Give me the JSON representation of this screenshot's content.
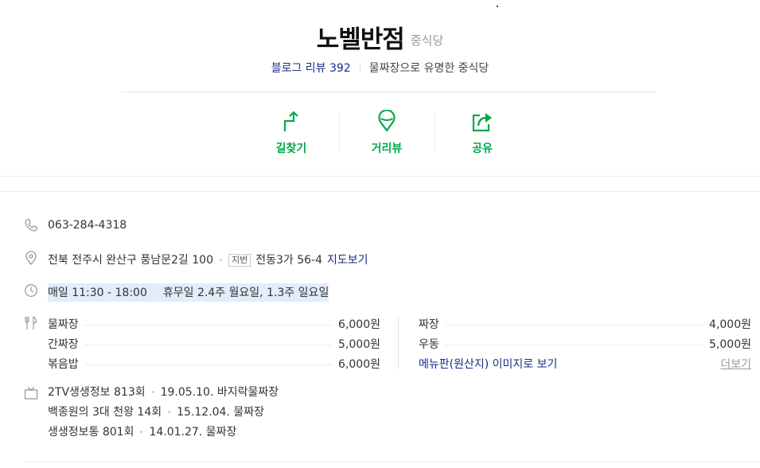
{
  "place": {
    "name": "노벨반점",
    "category": "중식당",
    "blog_review_label": "블로그 리뷰 392",
    "description": "물짜장으로 유명한 중식당"
  },
  "actions": [
    {
      "label": "길찾기",
      "icon": "directions-icon"
    },
    {
      "label": "거리뷰",
      "icon": "street-view-icon"
    },
    {
      "label": "공유",
      "icon": "share-icon"
    }
  ],
  "info": {
    "phone": "063-284-4318",
    "address": "전북 전주시 완산구 풍남문2길 100",
    "jibun_tag": "지번",
    "jibun_address": "전동3가 56-4",
    "map_link": "지도보기",
    "hours": "매일 11:30 - 18:00",
    "holiday": "휴무일 2.4주 월요일, 1.3주 일요일"
  },
  "menu": {
    "left": [
      {
        "name": "물짜장",
        "price": "6,000원"
      },
      {
        "name": "간짜장",
        "price": "5,000원"
      },
      {
        "name": "볶음밥",
        "price": "6,000원"
      }
    ],
    "right": [
      {
        "name": "짜장",
        "price": "4,000원"
      },
      {
        "name": "우동",
        "price": "5,000원"
      }
    ],
    "image_link": "메뉴판(원산지) 이미지로 보기",
    "more_link": "더보기"
  },
  "tv": [
    {
      "program": "2TV생생정보 813회",
      "detail": "19.05.10. 바지락물짜장"
    },
    {
      "program": "백종원의 3대 천왕 14회",
      "detail": "15.12.04. 물짜장"
    },
    {
      "program": "생생정보통 801회",
      "detail": "14.01.27. 물짜장"
    }
  ],
  "colors": {
    "accent_green": "#03a94d",
    "link_blue": "#1a2b8a",
    "hours_highlight": "#e2ecfa"
  }
}
